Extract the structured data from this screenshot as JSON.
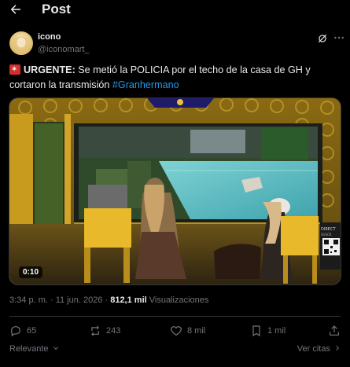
{
  "header": {
    "title": "Post"
  },
  "author": {
    "name": "icono",
    "handle": "@iconomart_"
  },
  "tweet": {
    "label": "URGENTE:",
    "text": " Se metió la POLICIA por el techo de la casa de GH y cortaron la transmisión ",
    "hashtag": "#Granhermano"
  },
  "media": {
    "duration": "0:10",
    "overlay_text": "DIRECT",
    "overlay_sub": "SUSCR"
  },
  "meta": {
    "datetime": "3:34 p. m. · 11 jun. 2026 · ",
    "views_count": "812,1 mil",
    "views_label": " Visualizaciones"
  },
  "actions": {
    "replies": "65",
    "reposts": "243",
    "likes": "8 mil",
    "bookmarks": "1 mil"
  },
  "footer": {
    "sort": "Relevante",
    "quotes": "Ver citas"
  },
  "colors": {
    "accent": "#1d9bf0",
    "muted": "#71767b",
    "text": "#e7e9ea",
    "siren": "#d32f2f"
  }
}
